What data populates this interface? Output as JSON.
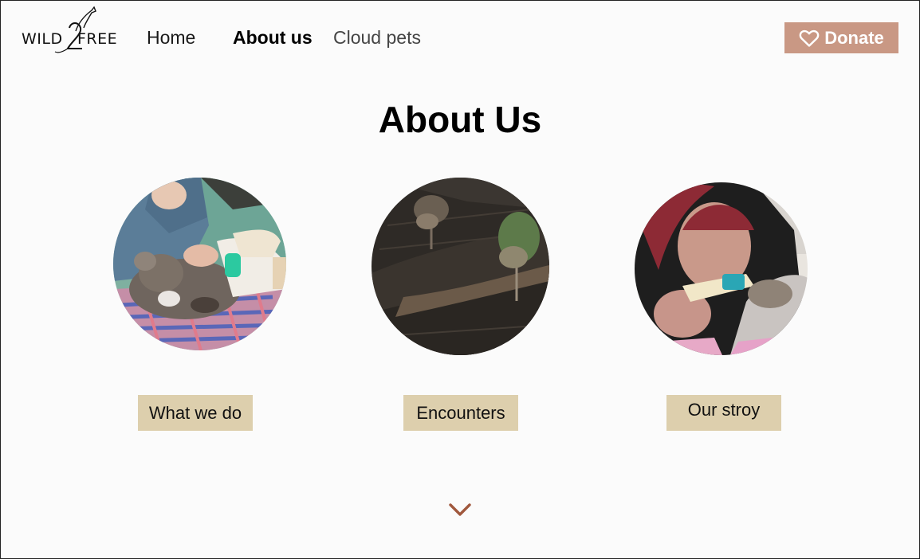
{
  "logo": {
    "left_text": "WILD",
    "number": "2",
    "right_text": "FREE"
  },
  "nav": {
    "items": [
      "Home",
      "About us",
      "Cloud pets"
    ],
    "active": "About us"
  },
  "donate": {
    "label": "Donate",
    "icon": "heart-icon",
    "color": "#c99884"
  },
  "page": {
    "title": "About Us"
  },
  "cards": [
    {
      "label": "What we do",
      "image": "koala-care-photo"
    },
    {
      "label": "Encounters",
      "image": "burnt-hillside-photo"
    },
    {
      "label": "Our stroy",
      "image": "joey-feeding-photo"
    }
  ],
  "scroll": {
    "icon": "chevron-down-icon",
    "color": "#a0583d"
  },
  "colors": {
    "tag_bg": "#ddcfad",
    "background": "#fbfbfb"
  }
}
